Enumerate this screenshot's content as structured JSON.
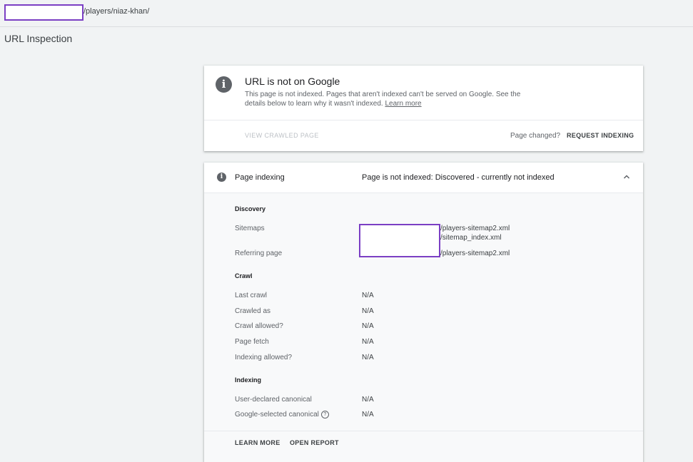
{
  "header": {
    "url_path": "/players/niaz-khan/"
  },
  "page": {
    "title": "URL Inspection"
  },
  "status_card": {
    "title": "URL is not on Google",
    "description": "This page is not indexed. Pages that aren't indexed can't be served on Google. See the details below to learn why it wasn't indexed.",
    "learn_more": "Learn more",
    "view_crawled": "VIEW CRAWLED PAGE",
    "page_changed": "Page changed?",
    "request_indexing": "REQUEST INDEXING",
    "icon": "info-icon"
  },
  "indexing_card": {
    "title": "Page indexing",
    "status": "Page is not indexed: Discovered - currently not indexed",
    "expanded": true,
    "discovery": {
      "heading": "Discovery",
      "sitemaps_label": "Sitemaps",
      "sitemaps": [
        "/players-sitemap2.xml",
        "/sitemap_index.xml"
      ],
      "referring_label": "Referring page",
      "referring": "/players-sitemap2.xml"
    },
    "crawl": {
      "heading": "Crawl",
      "rows": [
        {
          "label": "Last crawl",
          "value": "N/A"
        },
        {
          "label": "Crawled as",
          "value": "N/A"
        },
        {
          "label": "Crawl allowed?",
          "value": "N/A"
        },
        {
          "label": "Page fetch",
          "value": "N/A"
        },
        {
          "label": "Indexing allowed?",
          "value": "N/A"
        }
      ]
    },
    "indexing": {
      "heading": "Indexing",
      "rows": [
        {
          "label": "User-declared canonical",
          "value": "N/A"
        },
        {
          "label": "Google-selected canonical",
          "value": "N/A"
        }
      ]
    },
    "footer": {
      "learn_more": "LEARN MORE",
      "open_report": "OPEN REPORT"
    }
  },
  "colors": {
    "background": "#f1f3f4",
    "redaction_border": "#7b3fc4",
    "icon_gray": "#5f6368"
  }
}
